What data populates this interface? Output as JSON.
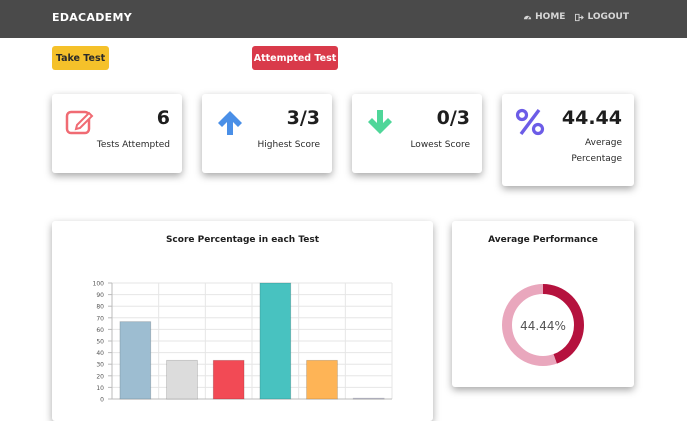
{
  "navbar": {
    "brand": "EDACADEMY",
    "home_label": "HOME",
    "logout_label": "LOGOUT"
  },
  "actions": {
    "take_test_label": "Take Test",
    "attempted_test_label": "Attempted Test"
  },
  "stats": [
    {
      "value": "6",
      "label": "Tests Attempted",
      "icon": "edit-icon",
      "color": "#f06b73"
    },
    {
      "value": "3/3",
      "label": "Highest Score",
      "icon": "arrow-up-icon",
      "color": "#4a8fe7"
    },
    {
      "value": "0/3",
      "label": "Lowest Score",
      "icon": "arrow-down-icon",
      "color": "#4fd699"
    },
    {
      "value": "44.44",
      "label_line1": "Average",
      "label_line2": "Percentage",
      "icon": "percent-icon",
      "color": "#6c5ce7"
    }
  ],
  "chart_data": [
    {
      "type": "bar",
      "title": "Score Percentage in each Test",
      "categories": [
        "",
        "",
        "",
        "",
        "",
        ""
      ],
      "values": [
        66.67,
        33.33,
        33.33,
        100,
        33.33,
        0
      ],
      "colors": [
        "#9dbdd1",
        "#dcdcdc",
        "#f24a55",
        "#48c2c0",
        "#feb456",
        "#c9c9dd"
      ],
      "ylim": [
        0,
        100
      ],
      "yticks": [
        "0",
        "10",
        "20",
        "30",
        "40",
        "50",
        "60",
        "70",
        "80",
        "90",
        "100"
      ],
      "grid": true
    },
    {
      "type": "pie",
      "title": "Average Performance",
      "values": [
        44.44,
        55.56
      ],
      "colors": [
        "#b5123e",
        "#e9a7bd"
      ],
      "center_label": "44.44%"
    }
  ]
}
